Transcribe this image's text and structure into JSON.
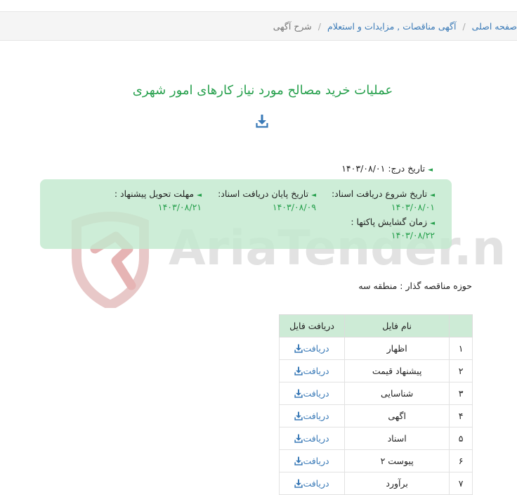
{
  "breadcrumb": {
    "home": "صفحه اصلی",
    "category": "آگهی مناقصات , مزایدات و استعلام",
    "current": "شرح آگهی"
  },
  "title": "عملیات خرید مصالح مورد نیاز کارهای امور شهری",
  "download_icon": "download-icon",
  "details": {
    "reg_date_label": "تاریخ درج:",
    "reg_date": "۱۴۰۳/۰۸/۰۱",
    "doc_start_label": "تاریخ شروع دریافت اسناد:",
    "doc_start": "۱۴۰۳/۰۸/۰۱",
    "doc_end_label": "تاریخ پایان دریافت اسناد:",
    "doc_end": "۱۴۰۳/۰۸/۰۹",
    "deadline_label": "مهلت تحویل پیشنهاد :",
    "deadline": "۱۴۰۳/۰۸/۲۱",
    "opening_label": "زمان گشایش پاکتها :",
    "opening": "۱۴۰۳/۰۸/۲۲",
    "zone": "حوزه مناقصه گذار : منطقه سه"
  },
  "watermark": "AriaTender.neT",
  "table": {
    "headers": [
      "",
      "نام فایل",
      "دریافت فایل"
    ],
    "download_label": "دریافت",
    "rows": [
      {
        "idx": "۱",
        "name": "اظهار"
      },
      {
        "idx": "۲",
        "name": "پیشنهاد قیمت"
      },
      {
        "idx": "۳",
        "name": "شناسایی"
      },
      {
        "idx": "۴",
        "name": "اگهی"
      },
      {
        "idx": "۵",
        "name": "اسناد"
      },
      {
        "idx": "۶",
        "name": "پیوست ۲"
      },
      {
        "idx": "۷",
        "name": "برآورد"
      }
    ]
  },
  "colors": {
    "accent": "#27a04d",
    "link": "#3a7ab7",
    "box": "#c2e9ce"
  }
}
